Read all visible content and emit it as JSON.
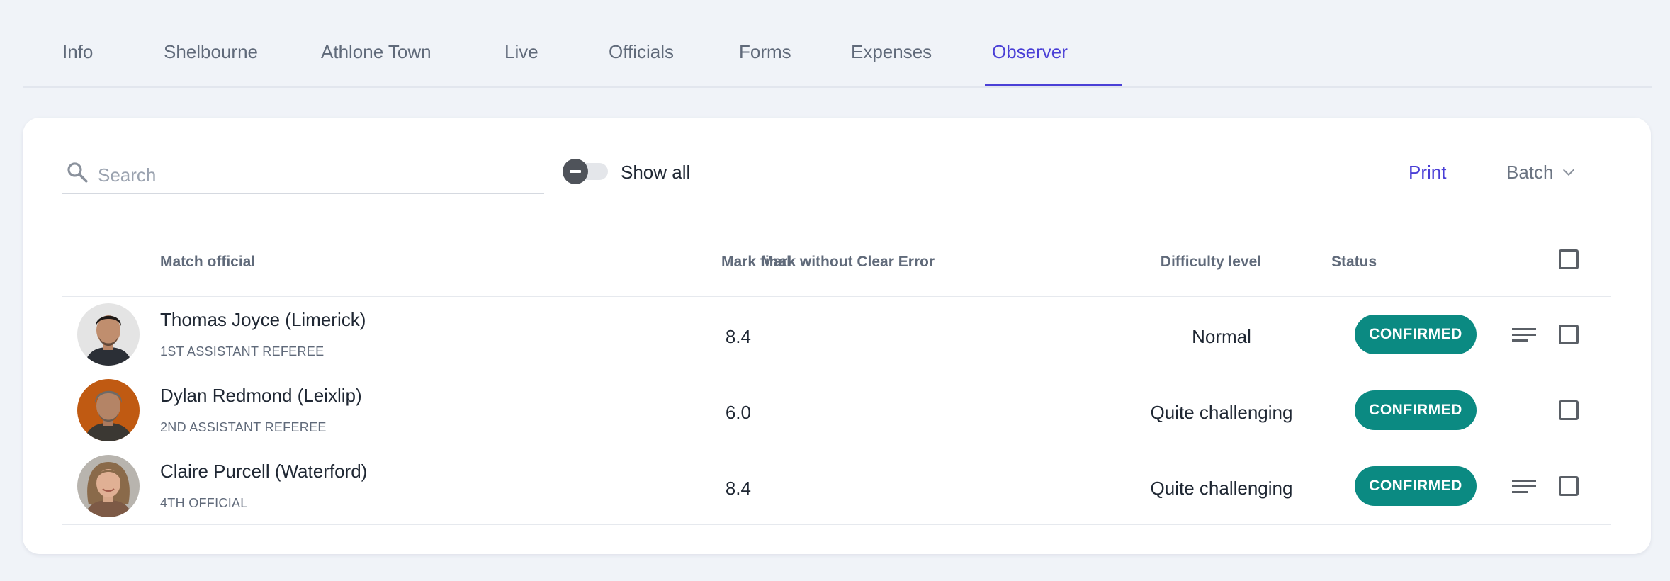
{
  "tabs": [
    {
      "label": "Info"
    },
    {
      "label": "Shelbourne"
    },
    {
      "label": "Athlone Town"
    },
    {
      "label": "Live"
    },
    {
      "label": "Officials"
    },
    {
      "label": "Forms"
    },
    {
      "label": "Expenses"
    },
    {
      "label": "Observer",
      "active": true
    }
  ],
  "toolbar": {
    "search_placeholder": "Search",
    "show_all_label": "Show all",
    "show_all_enabled": false,
    "print_label": "Print",
    "batch_label": "Batch"
  },
  "table": {
    "columns": {
      "official": "Match official",
      "mark_final": "Mark final",
      "mark_without_error": "Mark without Clear Error",
      "difficulty": "Difficulty level",
      "status": "Status"
    },
    "rows": [
      {
        "name": "Thomas Joyce (Limerick)",
        "role": "1ST ASSISTANT REFEREE",
        "mark_final": "8.4",
        "mark_without_error": "",
        "difficulty": "Normal",
        "status": "CONFIRMED",
        "has_notes": true
      },
      {
        "name": "Dylan Redmond (Leixlip)",
        "role": "2ND ASSISTANT REFEREE",
        "mark_final": "6.0",
        "mark_without_error": "",
        "difficulty": "Quite challenging",
        "status": "CONFIRMED",
        "has_notes": false
      },
      {
        "name": "Claire Purcell (Waterford)",
        "role": "4TH OFFICIAL",
        "mark_final": "8.4",
        "mark_without_error": "",
        "difficulty": "Quite challenging",
        "status": "CONFIRMED",
        "has_notes": true
      }
    ]
  },
  "colors": {
    "accent": "#4a3fd6",
    "status_confirmed": "#0b8a82",
    "background": "#f0f3f8"
  }
}
